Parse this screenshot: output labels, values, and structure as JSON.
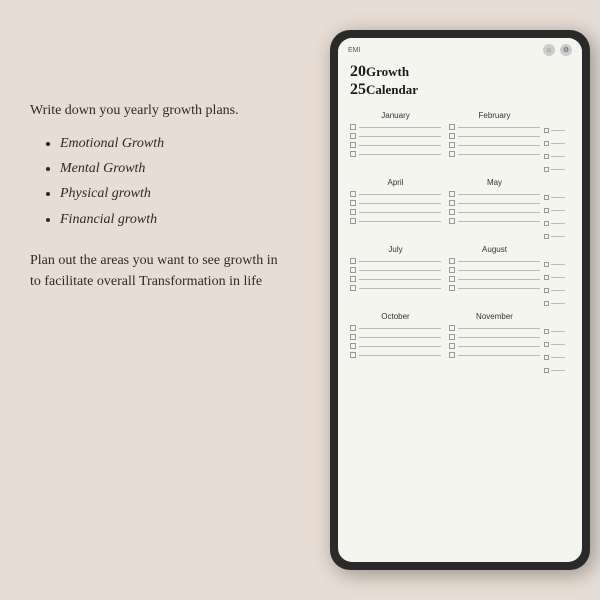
{
  "background_color": "#e8ddd4",
  "left": {
    "intro": "Write down you yearly growth plans.",
    "bullets": [
      "Emotional Growth",
      "Mental Growth",
      "Physical growth",
      "Financial growth"
    ],
    "outro": "Plan out the areas you want to see growth in to facilitate overall Transformation in life"
  },
  "tablet": {
    "top_label": "EMI",
    "title_year": "20",
    "title_word1": "Growth",
    "title_num2": "25",
    "title_word2": "Calendar",
    "months": [
      {
        "name": "January",
        "col": 1
      },
      {
        "name": "February",
        "col": 2
      },
      {
        "name": "April",
        "col": 1
      },
      {
        "name": "May",
        "col": 2
      },
      {
        "name": "July",
        "col": 1
      },
      {
        "name": "August",
        "col": 2
      },
      {
        "name": "October",
        "col": 1
      },
      {
        "name": "November",
        "col": 2
      }
    ]
  }
}
